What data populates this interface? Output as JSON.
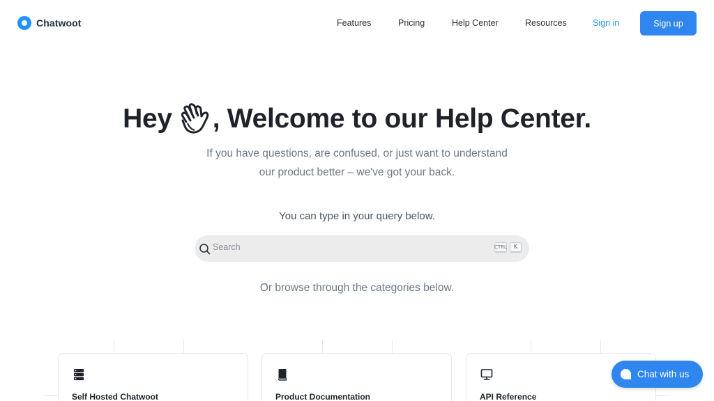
{
  "header": {
    "logo_text": "Chatwoot",
    "nav": {
      "features": "Features",
      "pricing": "Pricing",
      "help_center": "Help Center",
      "resources": "Resources",
      "sign_in": "Sign in",
      "sign_up": "Sign up"
    }
  },
  "hero": {
    "title_prefix": "Hey",
    "title_suffix": ", Welcome to our Help Center.",
    "wave_icon": "waving-hand-icon",
    "subtitle_line1": "If you have questions, are confused, or just want to understand",
    "subtitle_line2": "our product better – we've got your back.",
    "query_hint": "You can type in your query below."
  },
  "search": {
    "placeholder": "Search",
    "value": "",
    "shortcut_modifier": "CTRL",
    "shortcut_key": "K"
  },
  "browse_hint": "Or browse through the categories below.",
  "categories": [
    {
      "title": "Self Hosted Chatwoot",
      "icon": "server-icon"
    },
    {
      "title": "Product Documentation",
      "icon": "book-icon"
    },
    {
      "title": "API Reference",
      "icon": "monitor-icon"
    }
  ],
  "chat_widget": {
    "label": "Chat with us",
    "icon": "chat-bubble-icon"
  },
  "colors": {
    "accent": "#1f93ff",
    "button": "#2f86ee"
  }
}
